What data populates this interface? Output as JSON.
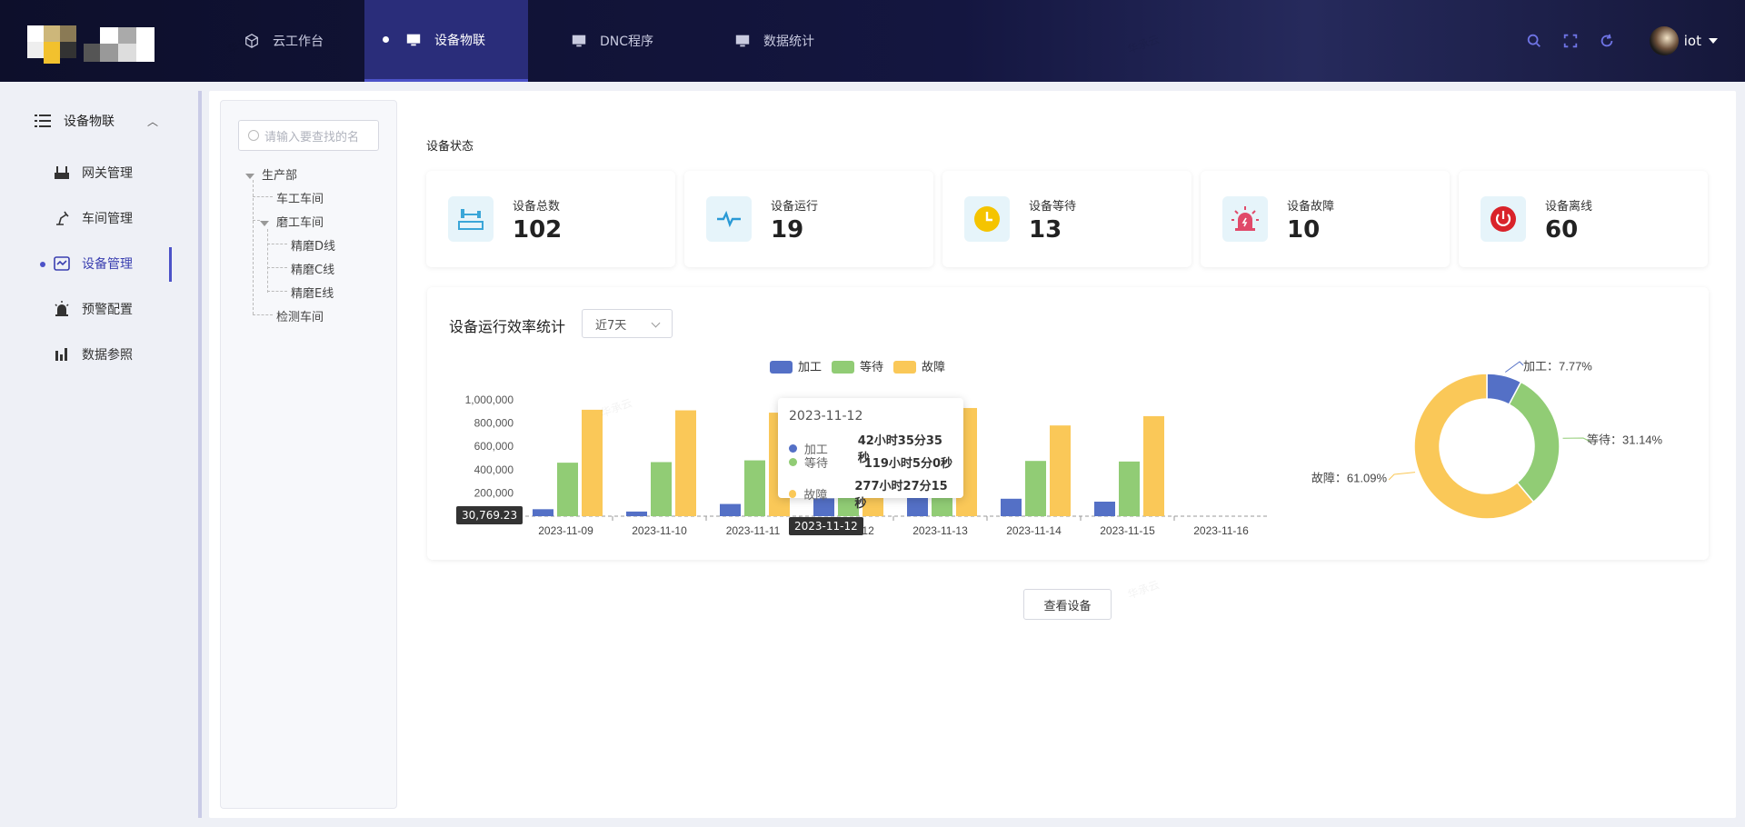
{
  "nav": {
    "items": [
      {
        "label": "云工作台",
        "icon": "cube-icon"
      },
      {
        "label": "设备物联",
        "icon": "monitor-icon"
      },
      {
        "label": "DNC程序",
        "icon": "monitor-icon"
      },
      {
        "label": "数据统计",
        "icon": "monitor-icon"
      }
    ],
    "active_index": 1
  },
  "user": {
    "name": "iot"
  },
  "sidebar": {
    "group_label": "设备物联",
    "items": [
      {
        "label": "网关管理",
        "icon": "gateway-icon"
      },
      {
        "label": "车间管理",
        "icon": "robot-arm-icon"
      },
      {
        "label": "设备管理",
        "icon": "device-icon"
      },
      {
        "label": "预警配置",
        "icon": "alarm-icon"
      },
      {
        "label": "数据参照",
        "icon": "bar-chart-icon"
      }
    ],
    "active_index": 2
  },
  "tree": {
    "search_placeholder": "请输入要查找的名",
    "nodes": [
      {
        "label": "生产部",
        "level": 0
      },
      {
        "label": "车工车间",
        "level": 1
      },
      {
        "label": "磨工车间",
        "level": 1
      },
      {
        "label": "精磨D线",
        "level": 2
      },
      {
        "label": "精磨C线",
        "level": 2
      },
      {
        "label": "精磨E线",
        "level": 2
      },
      {
        "label": "检测车间",
        "level": 1
      }
    ]
  },
  "status": {
    "section_title": "设备状态",
    "cards": [
      {
        "label": "设备总数",
        "value": "102",
        "icon": "production-line-icon",
        "color": "#3aa6d8"
      },
      {
        "label": "设备运行",
        "value": "19",
        "icon": "pulse-icon",
        "color": "#2a9ad6"
      },
      {
        "label": "设备等待",
        "value": "13",
        "icon": "clock-icon",
        "color": "#f5c400"
      },
      {
        "label": "设备故障",
        "value": "10",
        "icon": "alarm-light-icon",
        "color": "#e04a6a"
      },
      {
        "label": "设备离线",
        "value": "60",
        "icon": "power-icon",
        "color": "#d9232a"
      }
    ]
  },
  "efficiency": {
    "title": "设备运行效率统计",
    "range_select": "近7天",
    "view_button": "查看设备"
  },
  "tooltip": {
    "date": "2023-11-12",
    "rows": [
      {
        "label": "加工",
        "value": "42小时35分35秒",
        "color": "#5470c6"
      },
      {
        "label": "等待",
        "value": "119小时5分0秒",
        "color": "#91cc75"
      },
      {
        "label": "故障",
        "value": "277小时27分15秒",
        "color": "#fac858"
      }
    ]
  },
  "axis_pointer": {
    "y_label": "30,769.23",
    "x_label": "2023-11-12"
  },
  "colors": {
    "primary": "#4c52c8",
    "process": "#5470c6",
    "wait": "#91cc75",
    "fault": "#fac858"
  },
  "chart_data": [
    {
      "type": "bar",
      "categories": [
        "2023-11-09",
        "2023-11-10",
        "2023-11-11",
        "2023-11-12",
        "2023-11-13",
        "2023-11-14",
        "2023-11-15",
        "2023-11-16"
      ],
      "series": [
        {
          "name": "加工",
          "values": [
            60000,
            40000,
            105000,
            153335,
            170000,
            150000,
            125000,
            0
          ]
        },
        {
          "name": "等待",
          "values": [
            460000,
            465000,
            480000,
            428700,
            440000,
            475000,
            470000,
            0
          ]
        },
        {
          "name": "故障",
          "values": [
            915000,
            910000,
            890000,
            998835,
            930000,
            780000,
            860000,
            0
          ]
        }
      ],
      "yticks": [
        "200,000",
        "400,000",
        "600,000",
        "800,000",
        "1,000,000"
      ],
      "ylim": [
        0,
        1000000
      ],
      "legend": "top-center"
    },
    {
      "type": "pie",
      "labels": [
        "加工",
        "等待",
        "故障"
      ],
      "values": [
        7.77,
        31.14,
        61.09
      ],
      "display": [
        "加工：7.77%",
        "等待：31.14%",
        "故障：61.09%"
      ]
    }
  ]
}
